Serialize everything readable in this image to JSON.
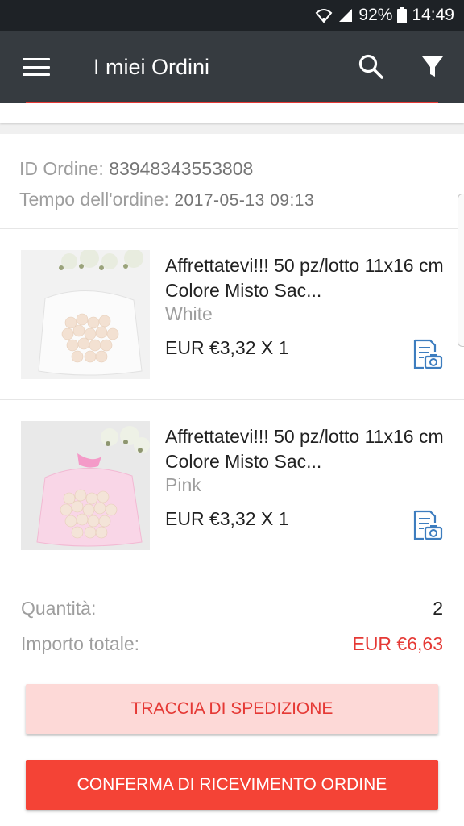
{
  "status_bar": {
    "battery": "92%",
    "time": "14:49",
    "icons": [
      "wifi-icon",
      "signal-icon",
      "battery-icon"
    ]
  },
  "app_bar": {
    "title": "I miei Ordini",
    "icons": [
      "menu-icon",
      "search-icon",
      "filter-icon"
    ]
  },
  "order": {
    "id_label": "ID Ordine:",
    "id_value": "83948343553808",
    "time_label": "Tempo dell'ordine:",
    "time_value": "2017-05-13 09:13"
  },
  "items": [
    {
      "title": "Affrettatevi!!! 50 pz/lotto 11x16 cm Colore Misto Sac...",
      "variant": "White",
      "price": "EUR €3,32 X 1",
      "thumb_color": "#f5f5f5"
    },
    {
      "title": "Affrettatevi!!! 50 pz/lotto 11x16 cm Colore Misto Sac...",
      "variant": "Pink",
      "price": "EUR €3,32 X 1",
      "thumb_color": "#f7c6dc"
    }
  ],
  "totals": {
    "quantity_label": "Quantità:",
    "quantity_value": "2",
    "amount_label": "Importo totale:",
    "amount_value": "EUR €6,63"
  },
  "buttons": {
    "track": "TRACCIA DI SPEDIZIONE",
    "confirm": "CONFERMA DI RICEVIMENTO ORDINE"
  },
  "colors": {
    "accent": "#e53935",
    "appbar": "#363b40",
    "statusbar": "#1e2226"
  }
}
